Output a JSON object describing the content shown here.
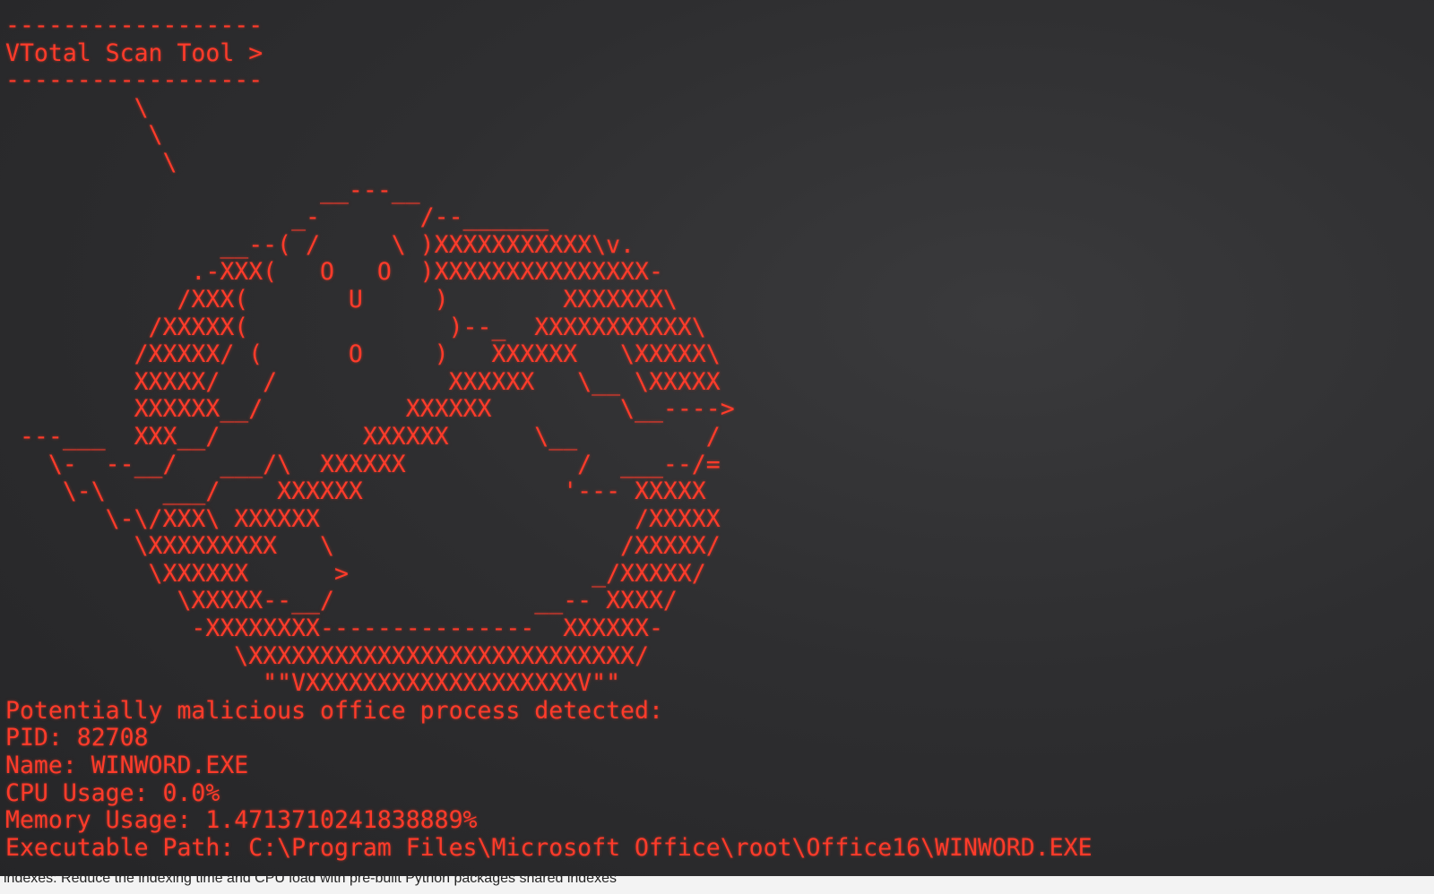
{
  "terminal": {
    "accent_color": "#ff3b2a",
    "header": {
      "rule_top": "------------------",
      "title": "VTotal Scan Tool >",
      "rule_bottom": "------------------"
    },
    "art_lines": [
      "         \\",
      "          \\",
      "           \\",
      "                      __---__",
      "                    _-       /--______",
      "               __--( /     \\ )XXXXXXXXXXX\\v.",
      "             .-XXX(   O   O  )XXXXXXXXXXXXXXX-",
      "            /XXX(       U     )        XXXXXXX\\",
      "          /XXXXX(              )--_  XXXXXXXXXXX\\",
      "         /XXXXX/ (      O     )   XXXXXX   \\XXXXX\\",
      "         XXXXX/   /            XXXXXX   \\__ \\XXXXX",
      "         XXXXXX__/          XXXXXX         \\__---->",
      " ---___  XXX__/          XXXXXX      \\__         /",
      "   \\-  --__/   ___/\\  XXXXXX            /  ___--/=",
      "    \\-\\    ___/    XXXXXX              '--- XXXXX",
      "       \\-\\/XXX\\ XXXXXX                      /XXXXX",
      "         \\XXXXXXXXX   \\                    /XXXXX/",
      "          \\XXXXXX      >                 _/XXXXX/",
      "            \\XXXXX--__/              __-- XXXX/",
      "             -XXXXXXXX---------------  XXXXXX-",
      "                \\XXXXXXXXXXXXXXXXXXXXXXXXXXX/",
      "                  \"\"VXXXXXXXXXXXXXXXXXXXV\"\""
    ],
    "output": {
      "alert": "Potentially malicious office process detected:",
      "pid": "PID: 82708",
      "name": "Name: WINWORD.EXE",
      "cpu": "CPU Usage: 0.0%",
      "memory": "Memory Usage: 1.4713710241838889%",
      "path": "Executable Path: C:\\Program Files\\Microsoft Office\\root\\Office16\\WINWORD.EXE"
    }
  },
  "bottom_bar": {
    "text": "indexes: Reduce the indexing time and CPU load with pre-built Python packages shared indexes"
  }
}
